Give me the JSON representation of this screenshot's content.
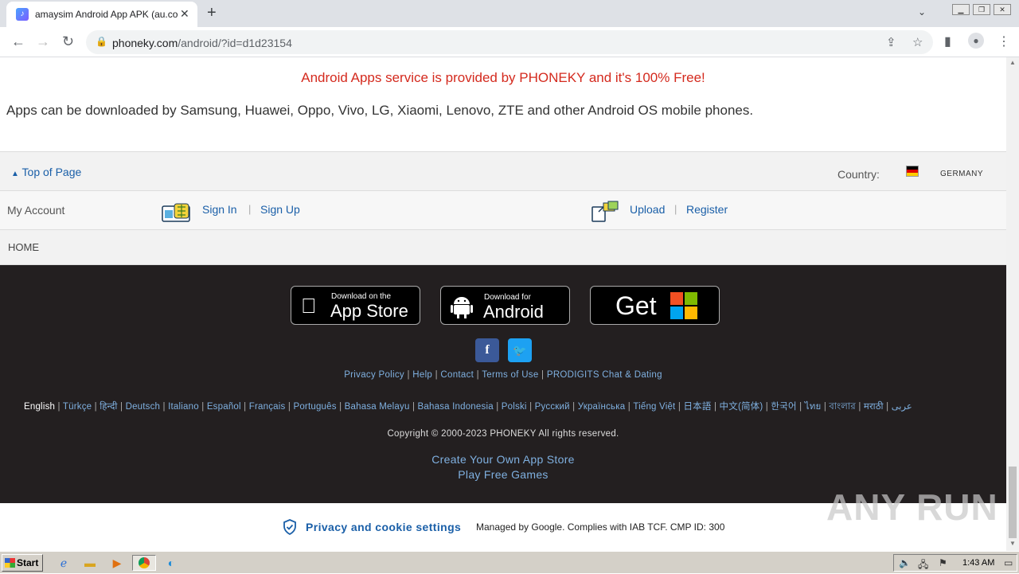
{
  "browser": {
    "tab_title": "amaysim Android App APK (au.com.a",
    "tab_favicon": "amaysim-app-icon",
    "url_host": "phoneky.com",
    "url_path": "/android/?id=d1d23154"
  },
  "page": {
    "free_note": "Android Apps service is provided by PHONEKY and it's 100% Free!",
    "devices_note": "Apps can be downloaded by Samsung, Huawei, Oppo, Vivo, LG, Xiaomi, Lenovo, ZTE and other Android OS mobile phones.",
    "top_of_page": "Top of Page",
    "country_label": "Country:",
    "country_name": "GERMANY",
    "my_account": "My Account",
    "sign_in": "Sign In",
    "sign_up": "Sign Up",
    "upload": "Upload",
    "register": "Register",
    "home": "HOME"
  },
  "footer": {
    "appstore_small": "Download on the",
    "appstore_big": "App Store",
    "android_small": "Download for",
    "android_big": "Android",
    "windows_big": "Get",
    "links": [
      "Privacy Policy",
      "Help",
      "Contact",
      "Terms of Use",
      "PRODIGITS Chat & Dating"
    ],
    "languages": [
      "English",
      "Türkçe",
      "हिन्दी",
      "Deutsch",
      "Italiano",
      "Español",
      "Français",
      "Português",
      "Bahasa Melayu",
      "Bahasa Indonesia",
      "Polski",
      "Русский",
      "Українська",
      "Tiếng Việt",
      "日本語",
      "中文(简体)",
      "한국어",
      "ไทย",
      "বাংলার",
      "मराठी",
      "عربى"
    ],
    "copyright": "Copyright © 2000-2023 PHONEKY All rights reserved.",
    "create_store": "Create Your Own App Store",
    "play_games": "Play Free Games"
  },
  "consent": {
    "privacy_settings": "Privacy and cookie settings",
    "managed": "Managed by Google. Complies with IAB TCF. CMP ID: 300"
  },
  "watermark": "ANY RUN",
  "taskbar": {
    "start": "Start",
    "clock": "1:43 AM"
  }
}
